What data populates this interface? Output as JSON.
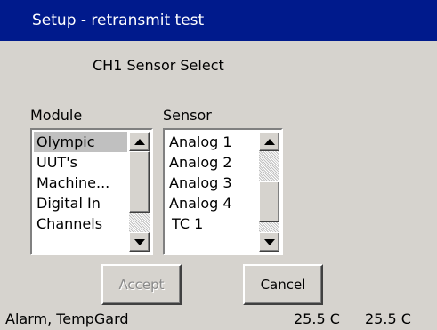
{
  "window": {
    "title": "Setup - retransmit test"
  },
  "heading": "CH1 Sensor Select",
  "module": {
    "label": "Module",
    "items": [
      "Olympic",
      "UUT's",
      "Machine...",
      "Digital In",
      "Channels"
    ],
    "selected": "Olympic"
  },
  "sensor": {
    "label": "Sensor",
    "items": [
      "Analog 1",
      "Analog 2",
      "Analog 3",
      "Analog 4",
      "TC 1"
    ],
    "selected": "TC 1"
  },
  "buttons": {
    "accept": "Accept",
    "cancel": "Cancel"
  },
  "status": {
    "message": "Alarm, TempGard",
    "value1": "25.5 C",
    "value2": "25.5 C"
  },
  "colors": {
    "title_bar": "#001a8c",
    "selection": "#08246b",
    "background": "#d6d3ce"
  }
}
